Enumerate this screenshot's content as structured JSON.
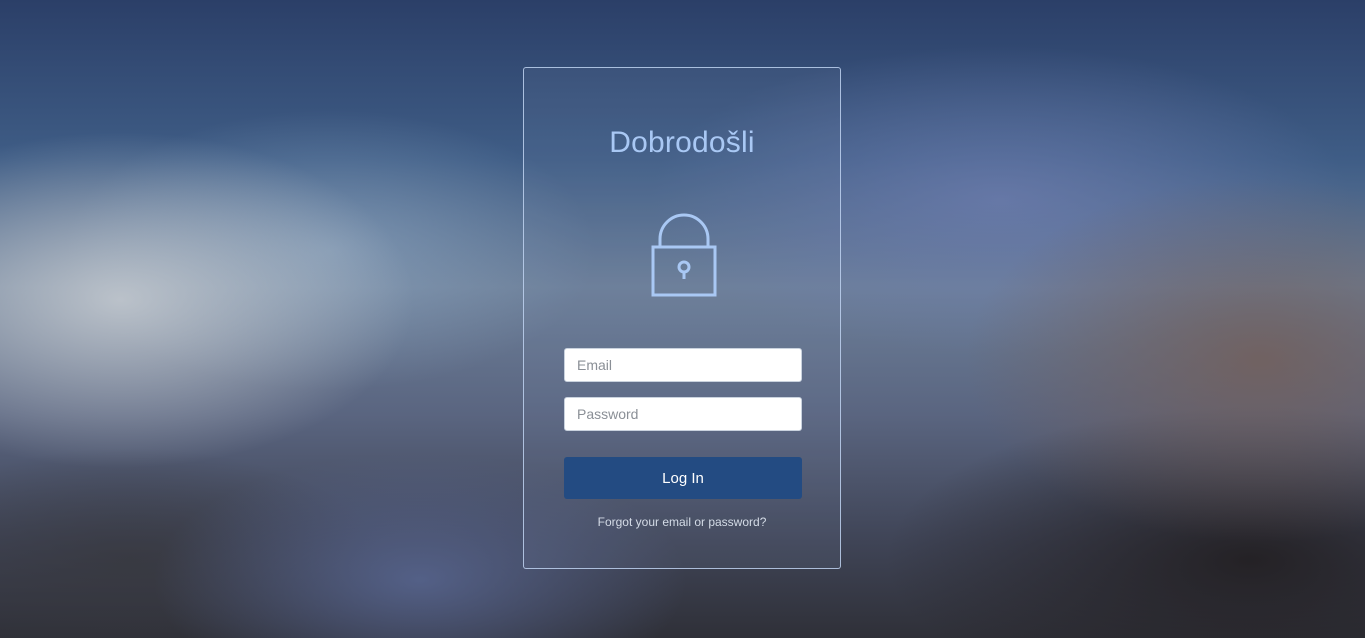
{
  "login": {
    "title": "Dobrodošli",
    "lock_icon": "padlock-icon",
    "email": {
      "value": "",
      "placeholder": "Email"
    },
    "password": {
      "value": "",
      "placeholder": "Password"
    },
    "login_button_label": "Log In",
    "forgot_link_text": "Forgot your email or password?"
  },
  "colors": {
    "title": "#a9c8f4",
    "lock": "#a9c8f4",
    "button_bg": "#234b82",
    "button_text": "#ffffff",
    "card_border": "#bed2f0"
  }
}
